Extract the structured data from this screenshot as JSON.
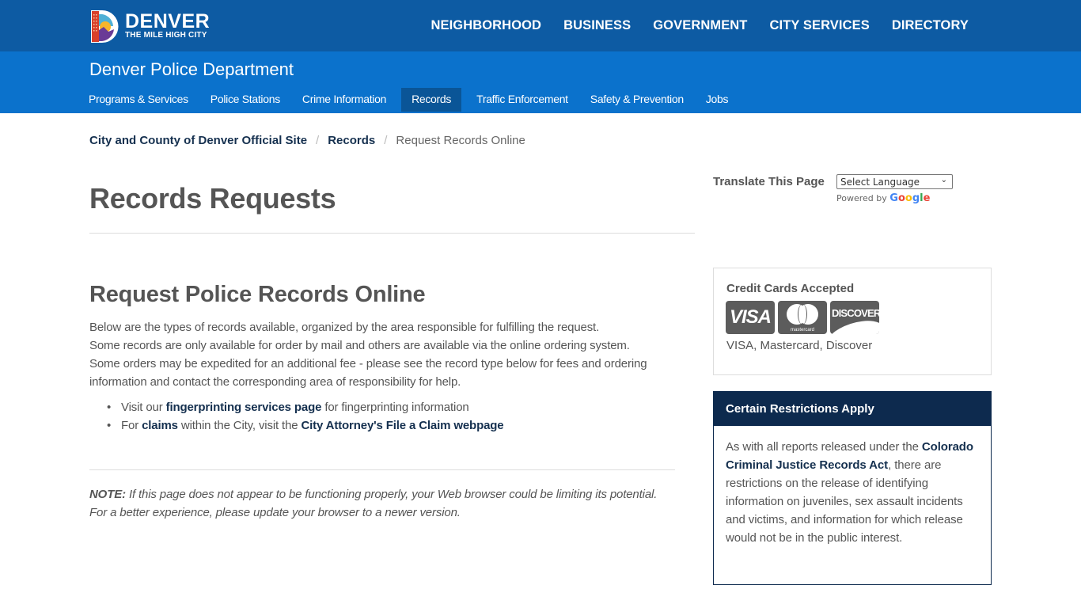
{
  "header": {
    "logo": {
      "title": "DENVER",
      "tagline": "THE MILE HIGH CITY"
    },
    "nav": [
      {
        "label": "NEIGHBORHOOD"
      },
      {
        "label": "BUSINESS"
      },
      {
        "label": "GOVERNMENT"
      },
      {
        "label": "CITY SERVICES"
      },
      {
        "label": "DIRECTORY"
      }
    ],
    "colors": {
      "topbar": "#0d5ba3",
      "deptbar": "#0b72cc",
      "active_tab": "#0a5597"
    }
  },
  "department": {
    "title": "Denver Police Department",
    "subnav": [
      {
        "label": "Programs & Services",
        "active": false
      },
      {
        "label": "Police Stations",
        "active": false
      },
      {
        "label": "Crime Information",
        "active": false
      },
      {
        "label": "Records",
        "active": true
      },
      {
        "label": "Traffic Enforcement",
        "active": false
      },
      {
        "label": "Safety & Prevention",
        "active": false
      },
      {
        "label": "Jobs",
        "active": false
      }
    ]
  },
  "breadcrumb": {
    "items": [
      {
        "label": "City and County of Denver Official Site"
      },
      {
        "label": "Records"
      }
    ],
    "separator": "/",
    "current": "Request Records Online"
  },
  "main": {
    "page_title": "Records Requests",
    "section_title": "Request Police Records Online",
    "intro_lines": [
      "Below are the types of records available, organized by the area responsible for fulfilling the request.",
      " Some records are only available for order by mail and others are available via the online ordering system.",
      " Some orders may be expedited for an additional fee - please see the record type below for fees and ordering information and contact the corresponding area of responsibility for help."
    ],
    "bullets": [
      {
        "pre": "Visit our ",
        "link": "fingerprinting services page",
        "post": " for fingerprinting information"
      },
      {
        "pre": "For ",
        "link": "claims",
        "mid": " within the City, visit the ",
        "link2": "City Attorney's File a Claim webpage"
      }
    ],
    "note": {
      "label": "NOTE:",
      "text": " If this page does not appear to be functioning properly, your Web browser could be limiting its potential.  For a better experience, please update your browser to a newer version."
    }
  },
  "sidebar": {
    "translate": {
      "label": "Translate This Page",
      "select_value": "Select Language",
      "powered_by": "Powered by",
      "google": [
        "G",
        "o",
        "o",
        "g",
        "l",
        "e"
      ]
    },
    "credit_cards": {
      "title": "Credit Cards Accepted",
      "icons": [
        {
          "icon": "visa-icon",
          "label": "VISA"
        },
        {
          "icon": "mastercard-icon",
          "label": "mastercard"
        },
        {
          "icon": "discover-icon",
          "label": "DISCOVER"
        }
      ],
      "text": "VISA, Mastercard, Discover"
    },
    "restrictions": {
      "title": "Certain Restrictions Apply",
      "pre": "As with all reports released under the ",
      "link": "Colorado Criminal Justice Records Act",
      "post": ", there are restrictions on the release of identifying information on juveniles, sex assault incidents and victims, and information for which release would not be in the public interest."
    }
  }
}
